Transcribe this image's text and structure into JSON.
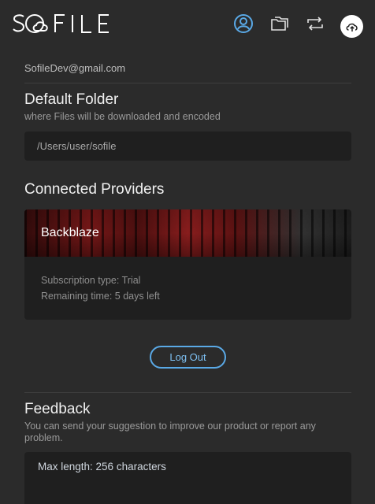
{
  "app": {
    "logo_text": "SOFILE"
  },
  "nav": {
    "items": [
      {
        "name": "account-icon",
        "active": true
      },
      {
        "name": "folder-icon",
        "active": false
      },
      {
        "name": "sync-icon",
        "active": false
      },
      {
        "name": "upload-icon",
        "active": false
      }
    ],
    "accent": "#5aa9e6"
  },
  "account": {
    "email": "SofileDev@gmail.com"
  },
  "default_folder": {
    "title": "Default Folder",
    "subtitle": "where Files will be downloaded and encoded",
    "value": "/Users/user/sofile"
  },
  "providers": {
    "title": "Connected Providers",
    "items": [
      {
        "name": "Backblaze",
        "subscription": "Subscription type: Trial",
        "remaining": "Remaining time: 5 days left"
      }
    ]
  },
  "logout_label": "Log Out",
  "feedback": {
    "title": "Feedback",
    "subtitle": "You can send your suggestion to improve our product or report any problem.",
    "placeholder": "Max length: 256 characters"
  }
}
